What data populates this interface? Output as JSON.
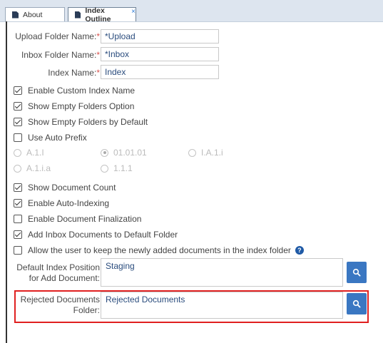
{
  "tabs": [
    {
      "label": "About"
    },
    {
      "label": "Index Outline",
      "close": "×"
    }
  ],
  "fields": {
    "upload_folder": {
      "label": "Upload Folder Name:",
      "required": "*",
      "value": "*Upload"
    },
    "inbox_folder": {
      "label": "Inbox Folder Name:",
      "required": "*",
      "value": "*Inbox"
    },
    "index_name": {
      "label": "Index Name:",
      "required": "*",
      "value": "Index"
    }
  },
  "options": {
    "enable_custom_index_name": {
      "label": "Enable Custom Index Name",
      "checked": true
    },
    "show_empty_folders_option": {
      "label": "Show Empty Folders Option",
      "checked": true
    },
    "show_empty_folders_default": {
      "label": "Show Empty Folders by Default",
      "checked": true
    },
    "use_auto_prefix": {
      "label": "Use Auto Prefix",
      "checked": false
    },
    "show_document_count": {
      "label": "Show Document Count",
      "checked": true
    },
    "enable_auto_indexing": {
      "label": "Enable Auto-Indexing",
      "checked": true
    },
    "enable_document_finalization": {
      "label": "Enable Document Finalization",
      "checked": false
    },
    "add_inbox_documents": {
      "label": "Add Inbox Documents to Default Folder",
      "checked": true
    },
    "allow_keep_new_docs": {
      "label": "Allow the user to keep the newly added documents in the index folder",
      "checked": false,
      "help": "?"
    }
  },
  "prefix_formats": [
    {
      "label": "A.1.I",
      "selected": false
    },
    {
      "label": "01.01.01",
      "selected": true
    },
    {
      "label": "I.A.1.i",
      "selected": false
    },
    {
      "label": "A.1.i.a",
      "selected": false
    },
    {
      "label": "1.1.1",
      "selected": false
    }
  ],
  "default_index_position": {
    "label_line1": "Default Index Position",
    "label_line2": "for Add Document:",
    "value": "Staging"
  },
  "rejected_documents_folder": {
    "label_line1": "Rejected Documents",
    "label_line2": "Folder:",
    "value": "Rejected Documents"
  },
  "colors": {
    "accent": "#3a77c2",
    "required": "#d9534f",
    "highlight": "#e02020",
    "value_text": "#2a4c7d"
  },
  "icons": {
    "tab": "document-icon",
    "search": "search-icon",
    "help": "help-icon"
  }
}
